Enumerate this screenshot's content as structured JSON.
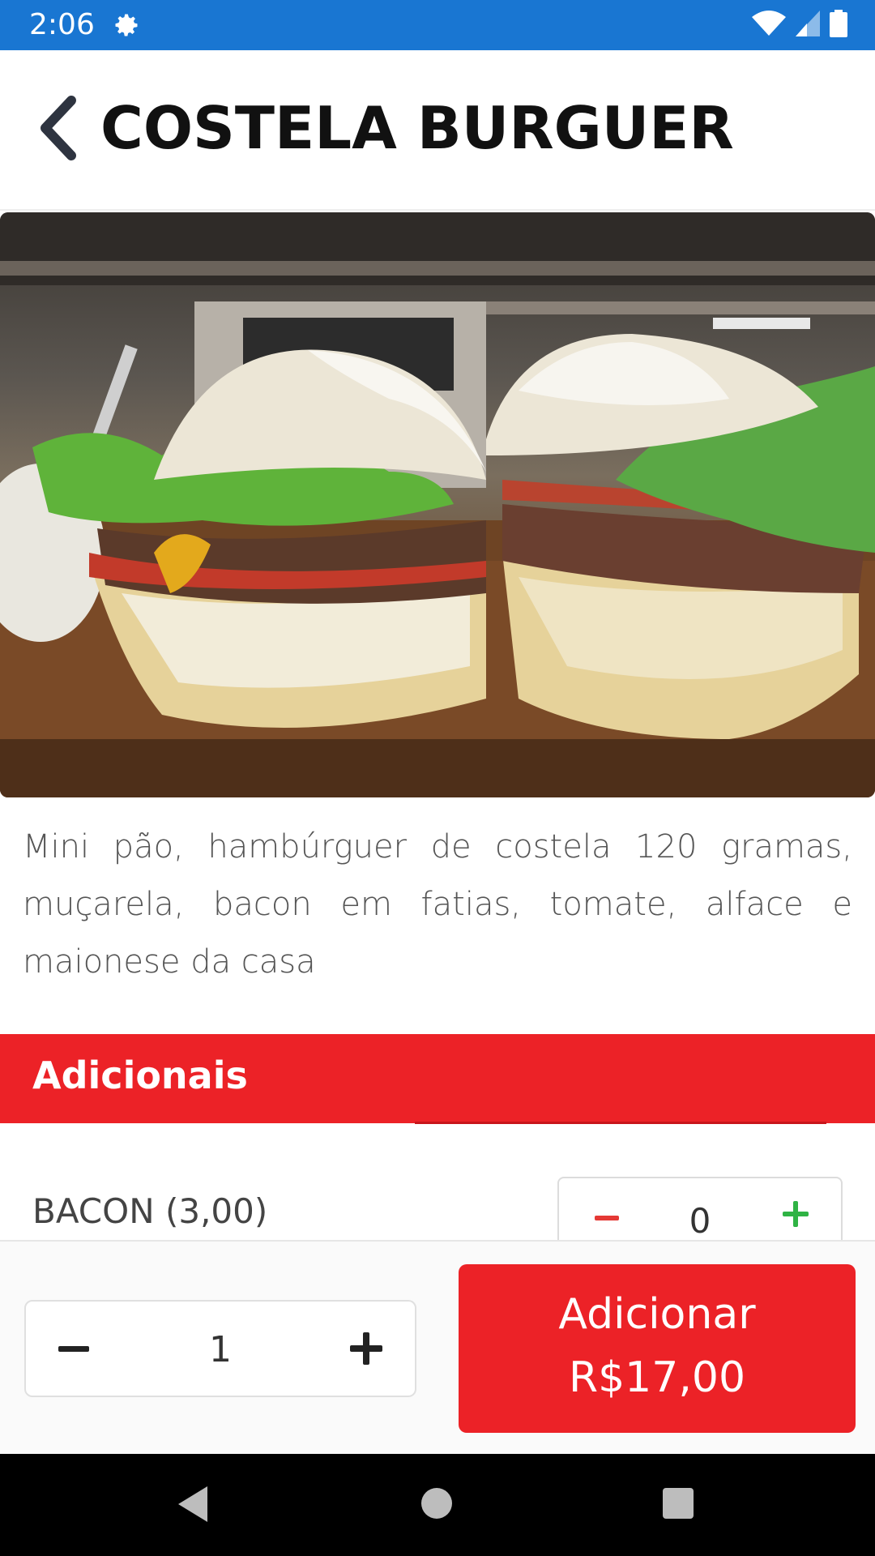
{
  "status_bar": {
    "time": "2:06",
    "icons": [
      "settings-gear-icon",
      "wifi-icon",
      "signal-icon",
      "battery-icon"
    ]
  },
  "header": {
    "title": "COSTELA BURGUER",
    "back_icon": "chevron-left-icon"
  },
  "product": {
    "image": "burger-photo",
    "description": "Mini pão, hambúrguer de costela 120 gramas, muçarela, bacon em fatias, tomate, alface e maionese da casa"
  },
  "additions": {
    "title": "Adicionais",
    "items": [
      {
        "label": "BACON (3,00)",
        "quantity": "0"
      }
    ]
  },
  "order": {
    "quantity": "1",
    "add_label": "Adicionar",
    "price": "R$17,00"
  },
  "colors": {
    "status_bar": "#1976d2",
    "accent_red": "#ec2227",
    "plus_green": "#2fb344",
    "minus_red": "#e53935"
  },
  "nav": {
    "icons": [
      "nav-back-icon",
      "nav-home-icon",
      "nav-recents-icon"
    ]
  }
}
